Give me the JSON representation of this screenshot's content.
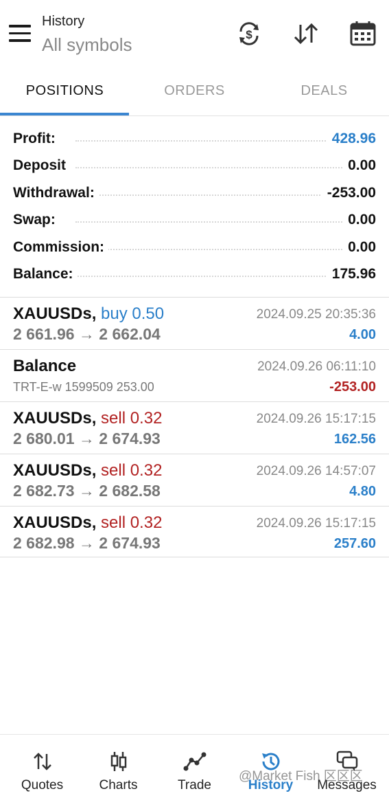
{
  "header": {
    "subtitle": "History",
    "title": "All symbols",
    "icons": [
      "sync-dollar-icon",
      "sort-icon",
      "calendar-icon"
    ]
  },
  "tabs": [
    {
      "label": "POSITIONS",
      "active": true
    },
    {
      "label": "ORDERS",
      "active": false
    },
    {
      "label": "DEALS",
      "active": false
    }
  ],
  "summary": [
    {
      "label": "Profit:",
      "value": "428.96",
      "color": "#2a7fc9"
    },
    {
      "label": "Deposit",
      "value": "0.00"
    },
    {
      "label": "Withdrawal:",
      "value": "-253.00"
    },
    {
      "label": "Swap:",
      "value": "0.00"
    },
    {
      "label": "Commission:",
      "value": "0.00"
    },
    {
      "label": "Balance:",
      "value": "175.96"
    }
  ],
  "items": [
    {
      "symbol": "XAUUSDs,",
      "side": "buy 0.50",
      "prices": "2 661.96 → 2 662.04",
      "time": "2024.09.25 20:35:36",
      "profit": "4.00"
    },
    {
      "symbol": "Balance",
      "side": "",
      "prices": "TRT-E-w 1599509 253.00",
      "time": "2024.09.26 06:11:10",
      "profit": "-253.00"
    },
    {
      "symbol": "XAUUSDs,",
      "side": "sell 0.32",
      "prices": "2 680.01 → 2 674.93",
      "time": "2024.09.26 15:17:15",
      "profit": "162.56"
    },
    {
      "symbol": "XAUUSDs,",
      "side": "sell 0.32",
      "prices": "2 682.73 → 2 682.58",
      "time": "2024.09.26 14:57:07",
      "profit": "4.80"
    },
    {
      "symbol": "XAUUSDs,",
      "side": "sell 0.32",
      "prices": "2 682.98 → 2 674.93",
      "time": "2024.09.26 15:17:15",
      "profit": "257.60"
    }
  ],
  "nav": [
    {
      "label": "Quotes",
      "icon": "quotes-icon"
    },
    {
      "label": "Charts",
      "icon": "charts-icon"
    },
    {
      "label": "Trade",
      "icon": "trade-icon"
    },
    {
      "label": "History",
      "icon": "history-icon",
      "active": true
    },
    {
      "label": "Messages",
      "icon": "messages-icon"
    }
  ],
  "watermark": "@Market Fish 区区区",
  "colors": {
    "accent": "#2a7fc9",
    "negative": "#b22222"
  }
}
